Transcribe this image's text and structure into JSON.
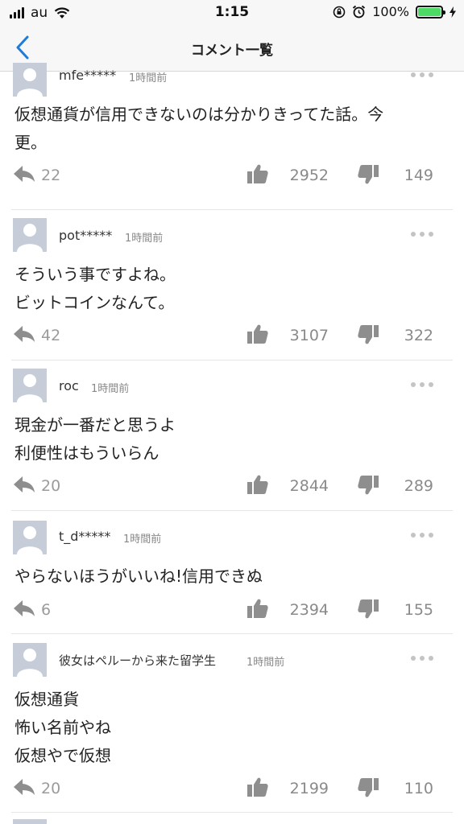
{
  "status_bar": {
    "carrier": "au",
    "time": "1:15",
    "battery_percent": "100%",
    "icons": [
      "signal-icon",
      "wifi-icon",
      "orientation-lock-icon",
      "alarm-icon",
      "battery-icon",
      "charging-icon"
    ]
  },
  "nav": {
    "title": "コメント一覧",
    "back_icon": "chevron-left-icon",
    "accent_color": "#1e7bd8"
  },
  "comments": [
    {
      "user": "mfe*****",
      "time": "1時間前",
      "lines": [
        "仮想通貨が信用できないのは分かりきってた話。今",
        "更。"
      ],
      "replies": "22",
      "likes": "2952",
      "dislikes": "149"
    },
    {
      "user": "pot*****",
      "time": "1時間前",
      "lines": [
        "そういう事ですよね。",
        "ビットコインなんて。"
      ],
      "replies": "42",
      "likes": "3107",
      "dislikes": "322"
    },
    {
      "user": "roc",
      "time": "1時間前",
      "lines": [
        "現金が一番だと思うよ",
        "利便性はもういらん"
      ],
      "replies": "20",
      "likes": "2844",
      "dislikes": "289"
    },
    {
      "user": "t_d*****",
      "time": "1時間前",
      "lines": [
        "やらないほうがいいね!信用できぬ"
      ],
      "replies": "6",
      "likes": "2394",
      "dislikes": "155"
    },
    {
      "user": "彼女はペルーから来た留学生",
      "time": "1時間前",
      "lines": [
        "仮想通貨",
        "怖い名前やね",
        "仮想やで仮想"
      ],
      "replies": "20",
      "likes": "2199",
      "dislikes": "110"
    }
  ]
}
